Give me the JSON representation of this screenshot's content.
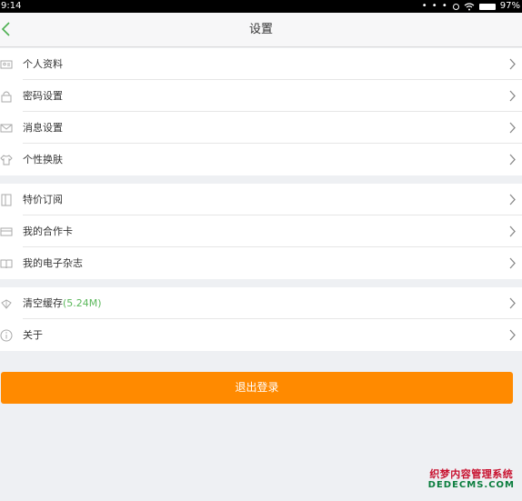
{
  "status_bar": {
    "time": "9:14",
    "dots": "• • •",
    "battery_percent": "97%"
  },
  "nav": {
    "title": "设置",
    "back_icon": "chevron-left-icon",
    "accent_color": "#4caf50"
  },
  "groups": [
    {
      "items": [
        {
          "label": "个人资料",
          "icon": "id-card-icon"
        },
        {
          "label": "密码设置",
          "icon": "lock-icon"
        },
        {
          "label": "消息设置",
          "icon": "envelope-icon"
        },
        {
          "label": "个性换肤",
          "icon": "shirt-icon"
        }
      ]
    },
    {
      "items": [
        {
          "label": "特价订阅",
          "icon": "book-icon"
        },
        {
          "label": "我的合作卡",
          "icon": "card-icon"
        },
        {
          "label": "我的电子杂志",
          "icon": "magazine-icon"
        }
      ]
    },
    {
      "items": [
        {
          "label": "清空缓存",
          "extra": "(5.24M)",
          "icon": "broom-icon"
        },
        {
          "label": "关于",
          "icon": "info-icon"
        }
      ]
    }
  ],
  "logout": {
    "label": "退出登录",
    "color": "#ff8a00"
  },
  "watermark": {
    "line1": "织梦内容管理系统",
    "line2": "DEDECMS.COM"
  }
}
